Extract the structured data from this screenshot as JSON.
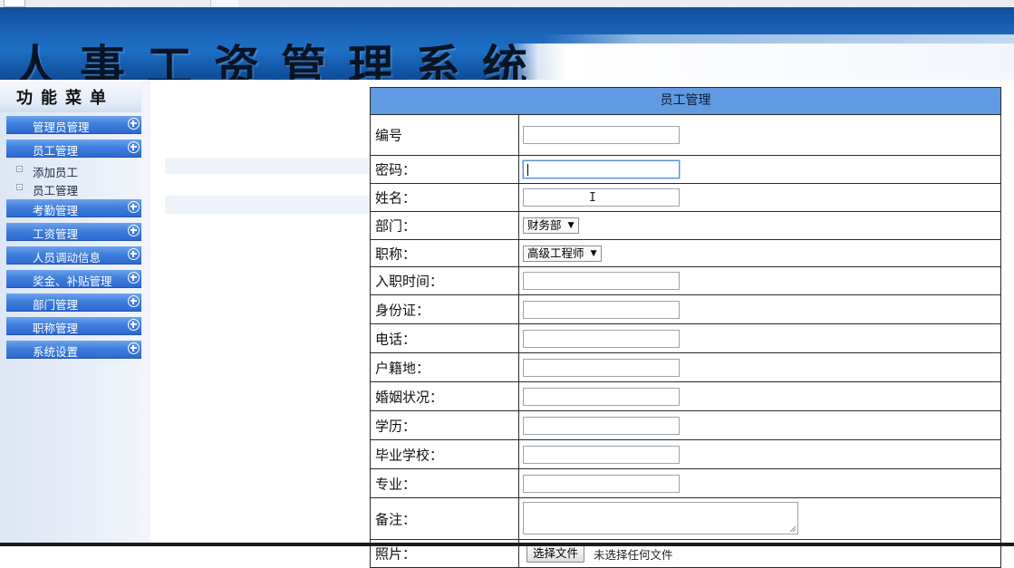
{
  "header": {
    "title": "人事工资管理系统"
  },
  "sidebar": {
    "title": "功能菜单",
    "items": [
      {
        "label": "管理员管理"
      },
      {
        "label": "员工管理"
      },
      {
        "label": "考勤管理"
      },
      {
        "label": "工资管理"
      },
      {
        "label": "人员调动信息"
      },
      {
        "label": "奖金、补贴管理"
      },
      {
        "label": "部门管理"
      },
      {
        "label": "职称管理"
      },
      {
        "label": "系统设置"
      }
    ],
    "subitems": [
      {
        "label": "添加员工"
      },
      {
        "label": "员工管理"
      }
    ]
  },
  "form": {
    "title": "员工管理",
    "labels": {
      "id": "编号",
      "password": "密码：",
      "name": "姓名：",
      "department": "部门：",
      "title": "职称：",
      "hire_date": "入职时间：",
      "id_card": "身份证：",
      "phone": "电话：",
      "hometown": "户籍地：",
      "marital": "婚姻状况：",
      "education": "学历：",
      "school": "毕业学校：",
      "major": "专业：",
      "notes": "备注：",
      "photo": "照片："
    },
    "department_selected": "财务部",
    "title_selected": "高级工程师",
    "file_button": "选择文件",
    "file_status": "未选择任何文件"
  },
  "icons": {
    "menu_expand": "plus-circle-icon",
    "select_arrow": "triangle-down-icon",
    "text_cursor": "ibeam-icon"
  },
  "colors": {
    "banner": "#1a64b7",
    "menu_item": "#3f7fdc",
    "form_header": "#5f9ae3"
  }
}
